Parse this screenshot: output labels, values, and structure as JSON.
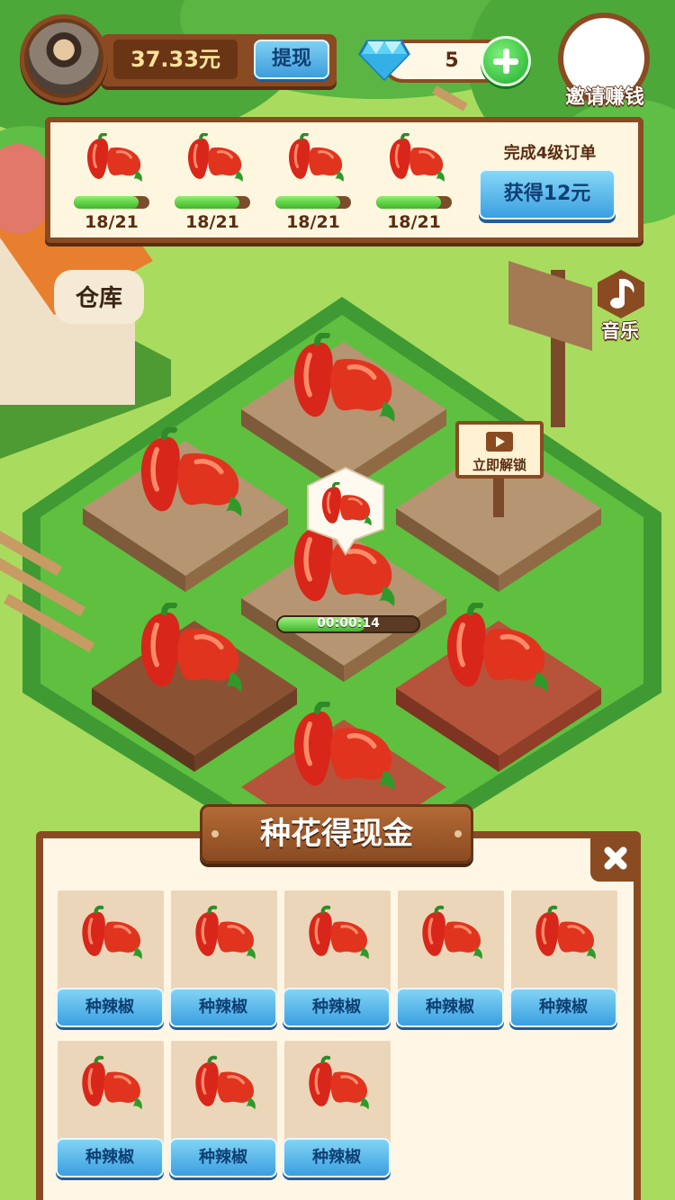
{
  "header": {
    "balance": "37.33元",
    "withdraw_label": "提现",
    "gem_count": "5",
    "invite_label": "邀请赚钱"
  },
  "orders": {
    "items": [
      {
        "count": "18/21",
        "progress": 0.857
      },
      {
        "count": "18/21",
        "progress": 0.857
      },
      {
        "count": "18/21",
        "progress": 0.857
      },
      {
        "count": "18/21",
        "progress": 0.857
      }
    ],
    "task_title": "完成4级订单",
    "reward_label": "获得12元"
  },
  "side": {
    "music_label": "音乐"
  },
  "farm": {
    "unlock_label": "立即解锁",
    "timer_text": "00:00:14",
    "timer_progress": 0.62,
    "warehouse_label": "仓库"
  },
  "seed_panel": {
    "title": "种花得现金",
    "seeds": [
      {
        "label": "种辣椒"
      },
      {
        "label": "种辣椒"
      },
      {
        "label": "种辣椒"
      },
      {
        "label": "种辣椒"
      },
      {
        "label": "种辣椒"
      },
      {
        "label": "种辣椒"
      },
      {
        "label": "种辣椒"
      },
      {
        "label": "种辣椒"
      }
    ]
  },
  "colors": {
    "wood": "#8a4b22",
    "button_blue": "#3a9fe0",
    "grass": "#8fcf4f",
    "progress_green": "#44b52f",
    "pepper_red": "#d9261a"
  }
}
